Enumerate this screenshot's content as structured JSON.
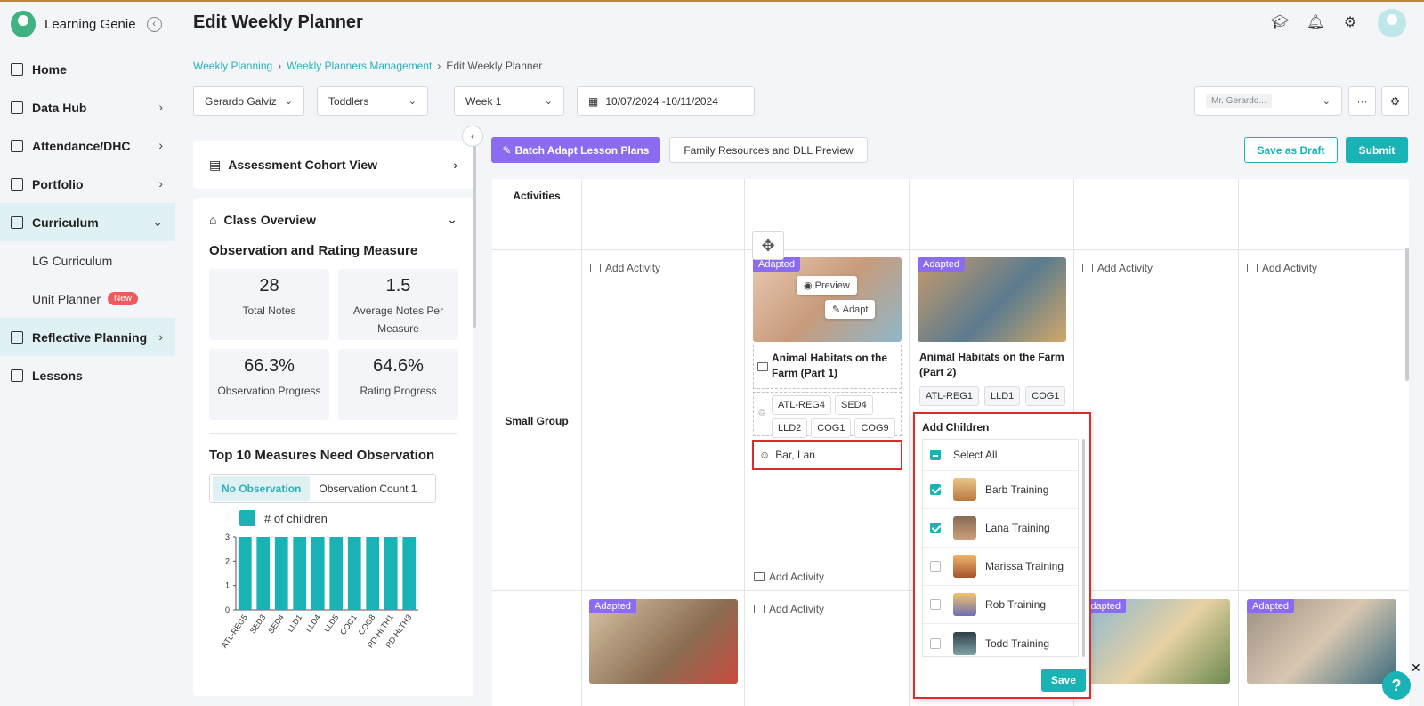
{
  "app": {
    "name": "Learning Genie"
  },
  "sidebar": {
    "items": [
      {
        "label": "Home"
      },
      {
        "label": "Data Hub"
      },
      {
        "label": "Attendance/DHC"
      },
      {
        "label": "Portfolio"
      },
      {
        "label": "Curriculum"
      },
      {
        "label": "LG Curriculum"
      },
      {
        "label": "Unit Planner",
        "badge": "New"
      },
      {
        "label": "Reflective Planning"
      },
      {
        "label": "Lessons"
      }
    ]
  },
  "header": {
    "title": "Edit Weekly Planner"
  },
  "breadcrumb": [
    "Weekly Planning",
    "Weekly Planners Management",
    "Edit Weekly Planner"
  ],
  "filters": {
    "teacher": "Gerardo Galviz",
    "group": "Toddlers",
    "week": "Week 1",
    "dates": "10/07/2024 -10/11/2024",
    "assignee": "Mr. Gerardo..."
  },
  "leftpanel": {
    "cohort_title": "Assessment Cohort View",
    "overview_title": "Class Overview",
    "section_title": "Observation and Rating Measure",
    "stats": [
      {
        "value": "28",
        "label": "Total Notes"
      },
      {
        "value": "1.5",
        "label": "Average Notes Per Measure"
      },
      {
        "value": "66.3%",
        "label": "Observation Progress"
      },
      {
        "value": "64.6%",
        "label": "Rating Progress"
      }
    ],
    "top10_title": "Top 10 Measures Need Observation",
    "tabs": [
      "No Observation",
      "Observation Count 1"
    ],
    "legend": "# of children"
  },
  "chart_data": {
    "type": "bar",
    "categories": [
      "ATL-REG5",
      "SED3",
      "SED4",
      "LLD1",
      "LLD4",
      "LLD5",
      "COG1",
      "COG8",
      "PD-HLTH1",
      "PD-HLTH3"
    ],
    "series": [
      {
        "name": "# of children",
        "values": [
          3,
          3,
          3,
          3,
          3,
          3,
          3,
          3,
          3,
          3
        ]
      }
    ],
    "yticks": [
      "0",
      "1",
      "2",
      "3"
    ],
    "ylim": [
      0,
      3
    ],
    "color": "#19b3b5"
  },
  "toolbar": {
    "batch": "Batch Adapt Lesson Plans",
    "family": "Family Resources and DLL Preview",
    "draft": "Save as Draft",
    "submit": "Submit"
  },
  "planner": {
    "row_activities": "Activities",
    "row_small_group": "Small Group",
    "add_activity": "Add Activity",
    "adapted": "Adapted",
    "preview": "Preview",
    "adapt": "Adapt",
    "lesson1": {
      "title": "Animal Habitats on the Farm (Part 1)",
      "tags": [
        "ATL-REG4",
        "SED4",
        "LLD2",
        "COG1",
        "COG9"
      ],
      "children": "Bar, Lan"
    },
    "lesson2": {
      "title": "Animal Habitats on the Farm (Part 2)",
      "tags": [
        "ATL-REG1",
        "LLD1",
        "COG1"
      ]
    }
  },
  "popup": {
    "title": "Add Children",
    "select_all": "Select All",
    "children": [
      {
        "name": "Barb Training",
        "checked": true
      },
      {
        "name": "Lana Training",
        "checked": true
      },
      {
        "name": "Marissa Training",
        "checked": false
      },
      {
        "name": "Rob Training",
        "checked": false
      },
      {
        "name": "Todd Training",
        "checked": false
      }
    ],
    "save": "Save"
  }
}
